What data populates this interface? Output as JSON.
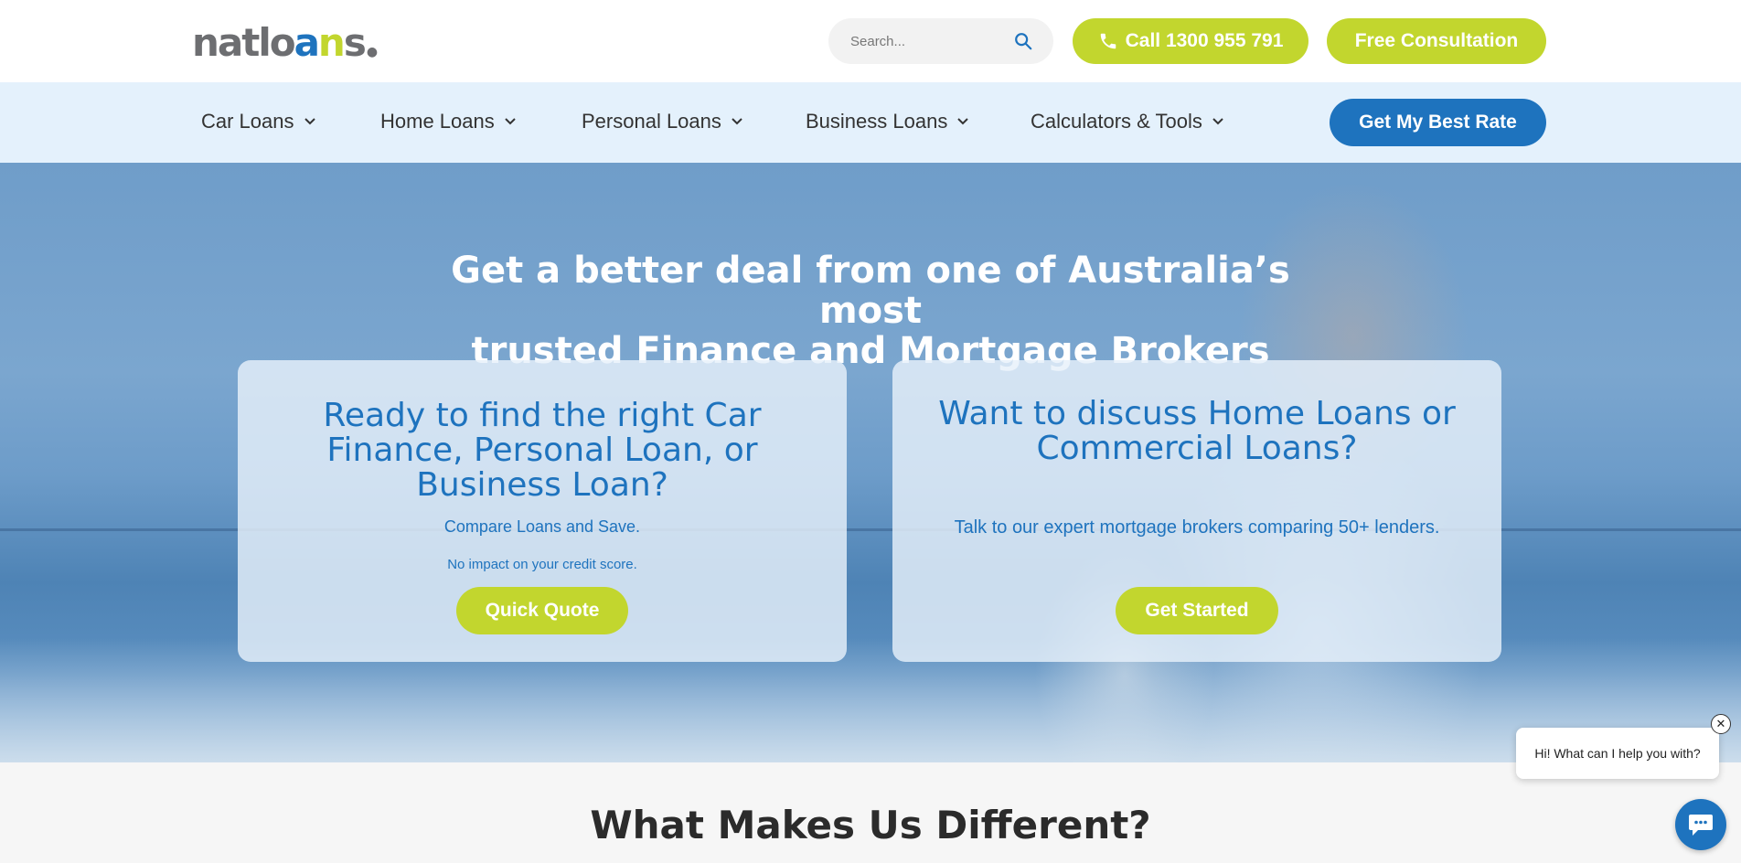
{
  "header": {
    "logo_text": "natloans",
    "search": {
      "placeholder": "Search..."
    },
    "call_label": "Call 1300 955 791",
    "consultation_label": "Free Consultation"
  },
  "nav": {
    "items": [
      {
        "label": "Car Loans"
      },
      {
        "label": "Home Loans"
      },
      {
        "label": "Personal Loans"
      },
      {
        "label": "Business Loans"
      },
      {
        "label": "Calculators & Tools"
      }
    ],
    "cta_label": "Get My Best Rate"
  },
  "hero": {
    "title_line1": "Get a better deal from one of Australia’s most",
    "title_line2": "trusted Finance and Mortgage Brokers",
    "card_left": {
      "heading": "Ready to find the right Car Finance, Personal Loan, or Business Loan?",
      "subtext": "Compare Loans and Save.",
      "note": "No impact on your credit score.",
      "button_label": "Quick Quote"
    },
    "card_right": {
      "heading": "Want to discuss Home Loans or Commercial Loans?",
      "subtext": "Talk to our expert mortgage brokers comparing 50+ lenders.",
      "button_label": "Get Started"
    }
  },
  "section": {
    "heading": "What Makes Us Different?"
  },
  "chat": {
    "message": "Hi! What can I help you with?",
    "close_glyph": "✕"
  },
  "colors": {
    "brand_blue": "#1e73be",
    "brand_green": "#c2d62e",
    "nav_bg": "#e4f1fc"
  }
}
